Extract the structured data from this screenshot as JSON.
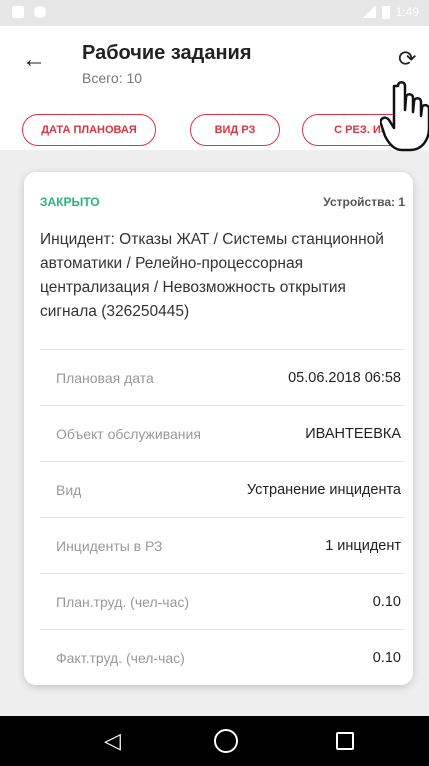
{
  "status_bar": {
    "time": "1:49"
  },
  "header": {
    "title": "Рабочие задания",
    "subtitle": "Всего: 10",
    "back_icon": "arrow-left-icon",
    "refresh_icon": "refresh-icon"
  },
  "filters": [
    {
      "label": "ДАТА ПЛАНОВАЯ"
    },
    {
      "label": "ВИД РЗ"
    },
    {
      "label": "С РЕЗ. ИЗМ"
    }
  ],
  "task": {
    "status": "ЗАКРЫТО",
    "devices": "Устройства: 1",
    "incident": "Инцидент: Отказы ЖАТ / Системы станционной автоматики / Релейно-процессорная централизация / Невозможность открытия сигнала (326250445)",
    "fields": [
      {
        "label": "Плановая дата",
        "value": "05.06.2018 06:58"
      },
      {
        "label": "Объект обслуживания",
        "value": "ИВАНТЕЕВКА"
      },
      {
        "label": "Вид",
        "value": "Устранение инцидента"
      },
      {
        "label": "Инциденты в РЗ",
        "value": "1 инцидент"
      },
      {
        "label": "План.труд. (чел-час)",
        "value": "0.10"
      },
      {
        "label": "Факт.труд. (чел-час)",
        "value": "0.10"
      }
    ]
  },
  "colors": {
    "accent": "#d9343f",
    "status_closed": "#2bb673"
  }
}
